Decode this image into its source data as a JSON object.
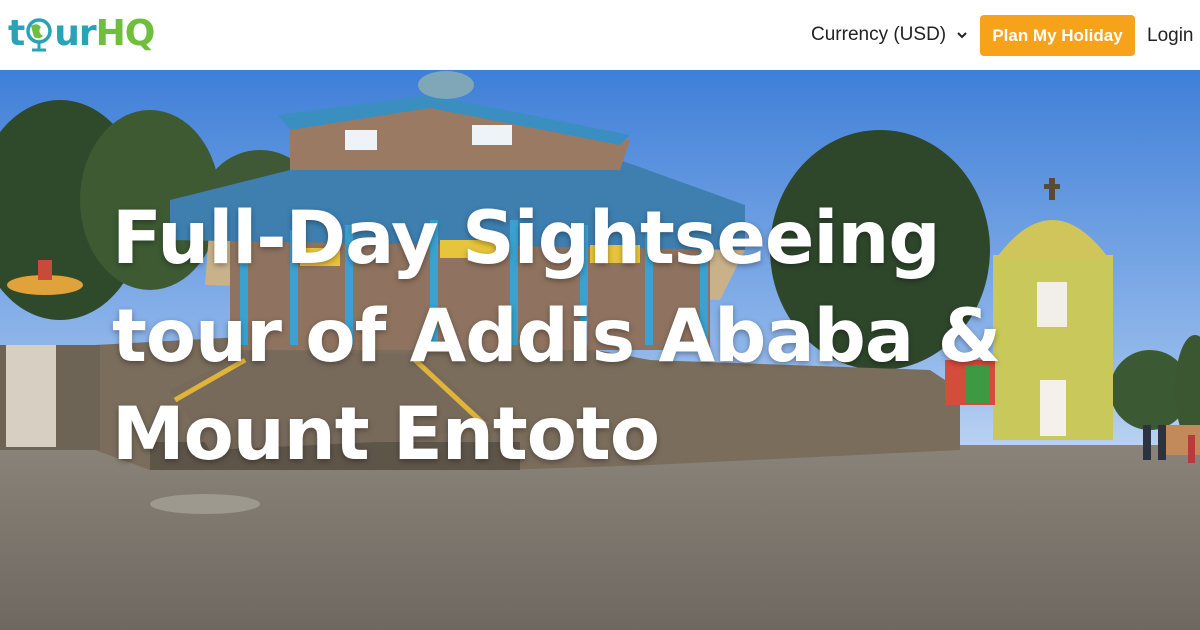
{
  "header": {
    "logo": {
      "part1": "t",
      "part2": "ur",
      "part3": "HQ"
    },
    "currency_label": "Currency (USD)",
    "plan_button": "Plan My Holiday",
    "login_label": "Login"
  },
  "hero": {
    "title": "Full-Day Sightseeing tour of Addis Ababa & Mount Entoto"
  },
  "colors": {
    "brand_teal": "#2aa3b6",
    "brand_green": "#6fbf3c",
    "accent_orange": "#f7a21b"
  }
}
